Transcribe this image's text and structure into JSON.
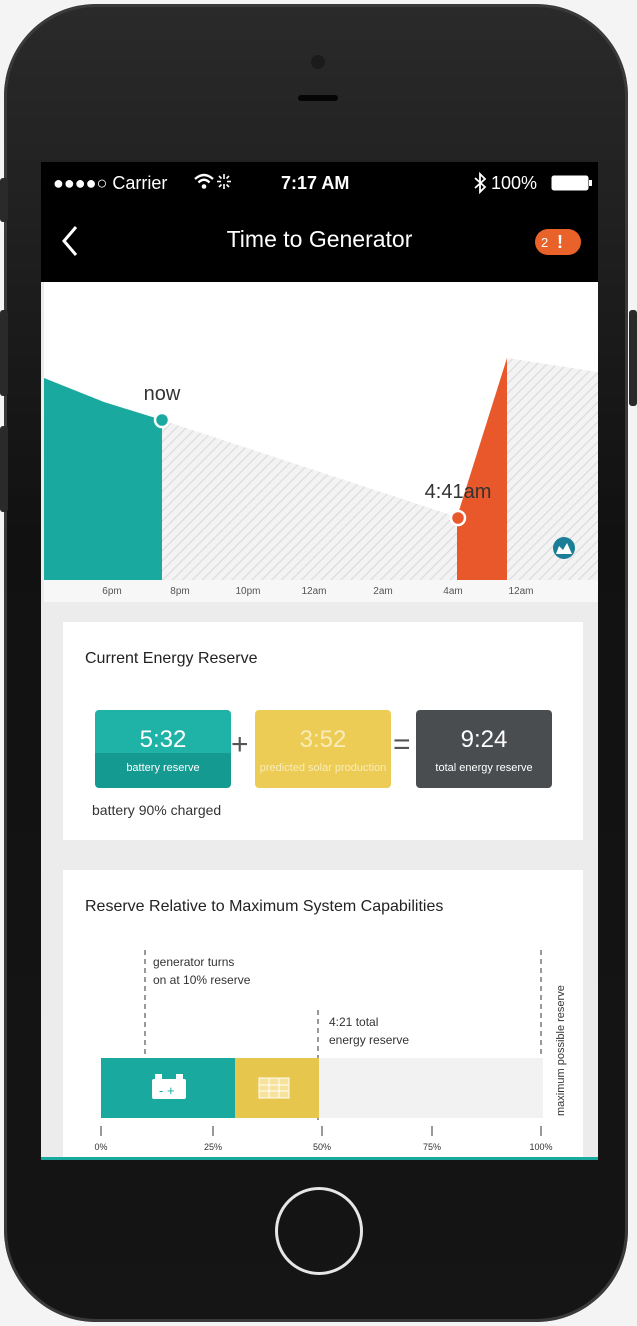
{
  "statusbar": {
    "carrier": "●●●●○ Carrier",
    "time": "7:17 AM",
    "battery": "100%"
  },
  "navbar": {
    "title": "Time to Generator",
    "alert_count": "2",
    "alert_mark": "!"
  },
  "timeline": {
    "now_label": "now",
    "generator_label": "4:41am",
    "ticks": [
      "6pm",
      "8pm",
      "10pm",
      "12am",
      "2am",
      "4am",
      "12am"
    ]
  },
  "energy_reserve": {
    "title": "Current Energy Reserve",
    "battery": {
      "value": "5:32",
      "label": "battery reserve",
      "note": "battery 90% charged"
    },
    "solar": {
      "value": "3:52",
      "label": "predicted solar production"
    },
    "total": {
      "value": "9:24",
      "label": "total energy reserve"
    },
    "plus": "+",
    "equals": "="
  },
  "capabilities": {
    "title": "Reserve Relative to Maximum System Capabilities",
    "generator_note_1": "generator turns",
    "generator_note_2": "on at 10% reserve",
    "total_note_1": "4:21 total",
    "total_note_2": "energy reserve",
    "max_label": "maximum possible reserve",
    "ticks": [
      "0%",
      "25%",
      "50%",
      "75%",
      "100%"
    ],
    "battery_fraction": 0.3,
    "solar_fraction": 0.19
  },
  "colors": {
    "teal": "#1aa99f",
    "orange": "#e8582a",
    "yellow": "#e6c64c",
    "dark": "#4a4d4f"
  }
}
